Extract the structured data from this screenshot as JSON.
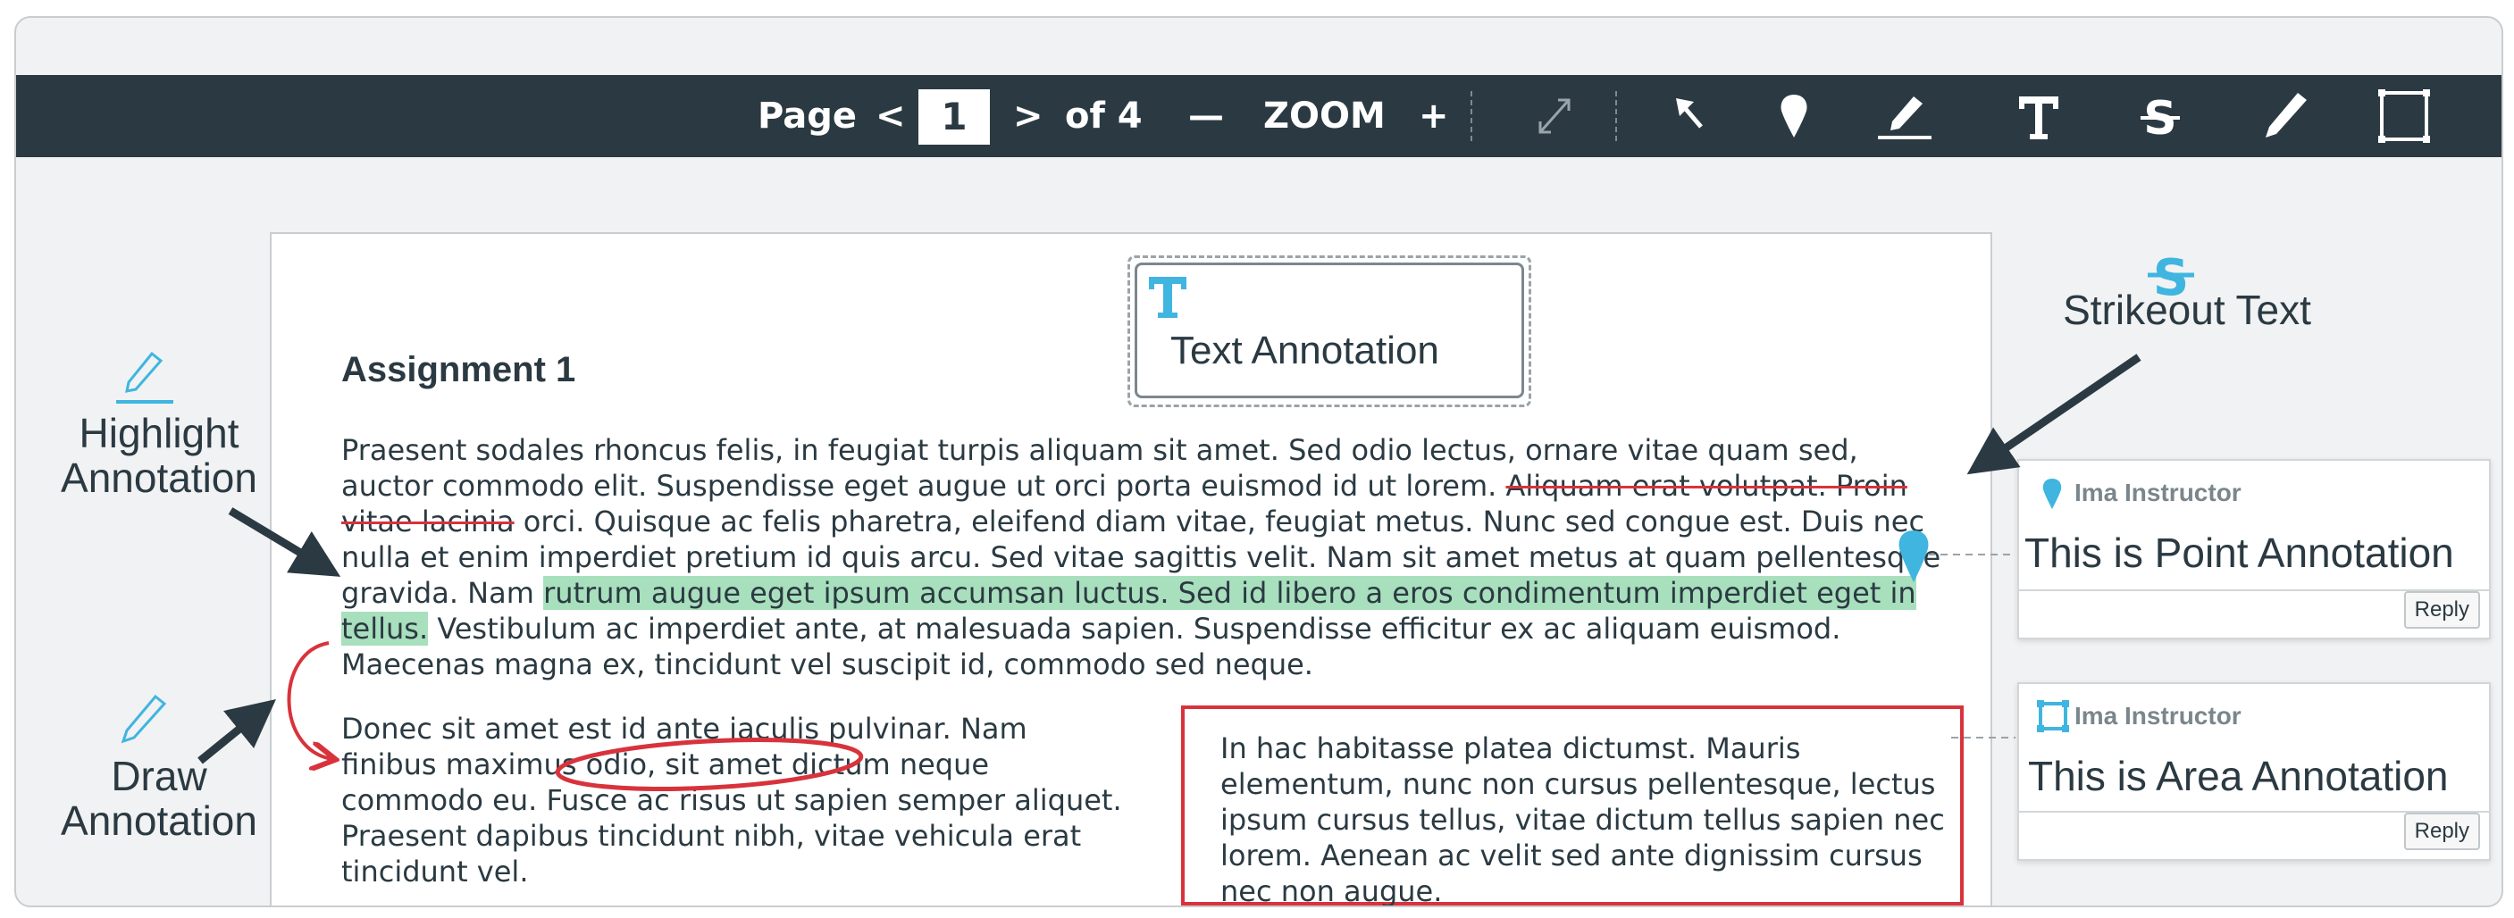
{
  "toolbar": {
    "page_label": "Page",
    "prev": "<",
    "page_value": "1",
    "next": ">",
    "of_label": "of 4",
    "zoom_out": "—",
    "zoom_label": "ZOOM",
    "zoom_in": "+"
  },
  "document": {
    "title": "Assignment 1",
    "p1_a": "Praesent sodales rhoncus felis, in feugiat turpis aliquam sit amet. Sed odio lectus, ornare vitae quam sed, auctor commodo elit. Suspendisse eget augue ut orci porta euismod id ut lorem. ",
    "p1_strike": "Aliquam erat volutpat. Proin vitae lacinia",
    "p1_b": " orci. Quisque ac felis pharetra, eleifend diam vitae, feugiat metus. Nunc sed congue est. Duis nec nulla et enim imperdiet pretium id quis arcu. Sed vitae sagittis velit. Nam sit amet metus at quam pellentesque gravida. Nam ",
    "p1_highlight": "rutrum augue eget ipsum accumsan luctus. Sed id libero a eros condimentum imperdiet eget in tellus.",
    "p1_c": " Vestibulum ac imperdiet ante, at malesuada sapien. Suspendisse efficitur ex ac aliquam euismod. Maecenas magna ex, tincidunt vel suscipit id, commodo sed neque.",
    "p2": "Donec sit amet est id ante iaculis pulvinar. Nam finibus maximus odio, sit amet dictum neque commodo eu. Fusce ac risus ut sapien semper aliquet. Praesent dapibus tincidunt nibh, vitae vehicula erat tincidunt vel.",
    "p3": "In hac habitasse platea dictumst. Mauris elementum, nunc non cursus pellentesque, lectus ipsum cursus tellus, vitae dictum tellus sapien nec lorem. Aenean ac velit sed ante dignissim cursus nec non augue."
  },
  "text_annotation": {
    "label": "Text Annotation"
  },
  "callouts": {
    "highlight_line1": "Highlight",
    "highlight_line2": "Annotation",
    "draw_line1": "Draw",
    "draw_line2": "Annotation",
    "strikeout": "Strikeout Text"
  },
  "comments": [
    {
      "author": "Ima Instructor",
      "text": "This is Point Annotation",
      "reply": "Reply",
      "icon": "pin-icon"
    },
    {
      "author": "Ima Instructor",
      "text": "This is Area Annotation",
      "reply": "Reply",
      "icon": "area-icon"
    }
  ],
  "colors": {
    "toolbar": "#2b3a42",
    "accent": "#3fb5e0",
    "highlight": "#a8dfbd",
    "strike": "#d8333c"
  }
}
